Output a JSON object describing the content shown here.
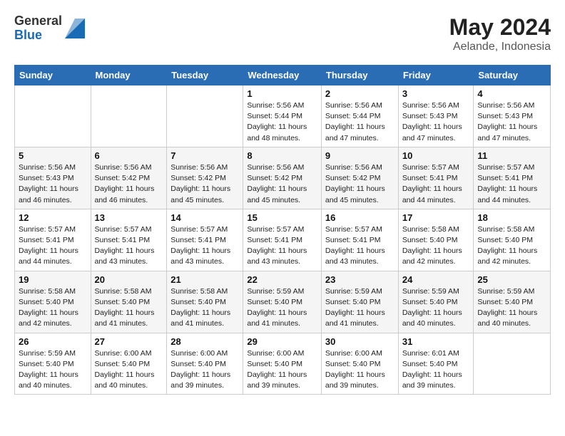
{
  "logo": {
    "general": "General",
    "blue": "Blue"
  },
  "title": {
    "month_year": "May 2024",
    "location": "Aelande, Indonesia"
  },
  "headers": [
    "Sunday",
    "Monday",
    "Tuesday",
    "Wednesday",
    "Thursday",
    "Friday",
    "Saturday"
  ],
  "weeks": [
    [
      {
        "day": "",
        "info": ""
      },
      {
        "day": "",
        "info": ""
      },
      {
        "day": "",
        "info": ""
      },
      {
        "day": "1",
        "info": "Sunrise: 5:56 AM\nSunset: 5:44 PM\nDaylight: 11 hours\nand 48 minutes."
      },
      {
        "day": "2",
        "info": "Sunrise: 5:56 AM\nSunset: 5:44 PM\nDaylight: 11 hours\nand 47 minutes."
      },
      {
        "day": "3",
        "info": "Sunrise: 5:56 AM\nSunset: 5:43 PM\nDaylight: 11 hours\nand 47 minutes."
      },
      {
        "day": "4",
        "info": "Sunrise: 5:56 AM\nSunset: 5:43 PM\nDaylight: 11 hours\nand 47 minutes."
      }
    ],
    [
      {
        "day": "5",
        "info": "Sunrise: 5:56 AM\nSunset: 5:43 PM\nDaylight: 11 hours\nand 46 minutes."
      },
      {
        "day": "6",
        "info": "Sunrise: 5:56 AM\nSunset: 5:42 PM\nDaylight: 11 hours\nand 46 minutes."
      },
      {
        "day": "7",
        "info": "Sunrise: 5:56 AM\nSunset: 5:42 PM\nDaylight: 11 hours\nand 45 minutes."
      },
      {
        "day": "8",
        "info": "Sunrise: 5:56 AM\nSunset: 5:42 PM\nDaylight: 11 hours\nand 45 minutes."
      },
      {
        "day": "9",
        "info": "Sunrise: 5:56 AM\nSunset: 5:42 PM\nDaylight: 11 hours\nand 45 minutes."
      },
      {
        "day": "10",
        "info": "Sunrise: 5:57 AM\nSunset: 5:41 PM\nDaylight: 11 hours\nand 44 minutes."
      },
      {
        "day": "11",
        "info": "Sunrise: 5:57 AM\nSunset: 5:41 PM\nDaylight: 11 hours\nand 44 minutes."
      }
    ],
    [
      {
        "day": "12",
        "info": "Sunrise: 5:57 AM\nSunset: 5:41 PM\nDaylight: 11 hours\nand 44 minutes."
      },
      {
        "day": "13",
        "info": "Sunrise: 5:57 AM\nSunset: 5:41 PM\nDaylight: 11 hours\nand 43 minutes."
      },
      {
        "day": "14",
        "info": "Sunrise: 5:57 AM\nSunset: 5:41 PM\nDaylight: 11 hours\nand 43 minutes."
      },
      {
        "day": "15",
        "info": "Sunrise: 5:57 AM\nSunset: 5:41 PM\nDaylight: 11 hours\nand 43 minutes."
      },
      {
        "day": "16",
        "info": "Sunrise: 5:57 AM\nSunset: 5:41 PM\nDaylight: 11 hours\nand 43 minutes."
      },
      {
        "day": "17",
        "info": "Sunrise: 5:58 AM\nSunset: 5:40 PM\nDaylight: 11 hours\nand 42 minutes."
      },
      {
        "day": "18",
        "info": "Sunrise: 5:58 AM\nSunset: 5:40 PM\nDaylight: 11 hours\nand 42 minutes."
      }
    ],
    [
      {
        "day": "19",
        "info": "Sunrise: 5:58 AM\nSunset: 5:40 PM\nDaylight: 11 hours\nand 42 minutes."
      },
      {
        "day": "20",
        "info": "Sunrise: 5:58 AM\nSunset: 5:40 PM\nDaylight: 11 hours\nand 41 minutes."
      },
      {
        "day": "21",
        "info": "Sunrise: 5:58 AM\nSunset: 5:40 PM\nDaylight: 11 hours\nand 41 minutes."
      },
      {
        "day": "22",
        "info": "Sunrise: 5:59 AM\nSunset: 5:40 PM\nDaylight: 11 hours\nand 41 minutes."
      },
      {
        "day": "23",
        "info": "Sunrise: 5:59 AM\nSunset: 5:40 PM\nDaylight: 11 hours\nand 41 minutes."
      },
      {
        "day": "24",
        "info": "Sunrise: 5:59 AM\nSunset: 5:40 PM\nDaylight: 11 hours\nand 40 minutes."
      },
      {
        "day": "25",
        "info": "Sunrise: 5:59 AM\nSunset: 5:40 PM\nDaylight: 11 hours\nand 40 minutes."
      }
    ],
    [
      {
        "day": "26",
        "info": "Sunrise: 5:59 AM\nSunset: 5:40 PM\nDaylight: 11 hours\nand 40 minutes."
      },
      {
        "day": "27",
        "info": "Sunrise: 6:00 AM\nSunset: 5:40 PM\nDaylight: 11 hours\nand 40 minutes."
      },
      {
        "day": "28",
        "info": "Sunrise: 6:00 AM\nSunset: 5:40 PM\nDaylight: 11 hours\nand 39 minutes."
      },
      {
        "day": "29",
        "info": "Sunrise: 6:00 AM\nSunset: 5:40 PM\nDaylight: 11 hours\nand 39 minutes."
      },
      {
        "day": "30",
        "info": "Sunrise: 6:00 AM\nSunset: 5:40 PM\nDaylight: 11 hours\nand 39 minutes."
      },
      {
        "day": "31",
        "info": "Sunrise: 6:01 AM\nSunset: 5:40 PM\nDaylight: 11 hours\nand 39 minutes."
      },
      {
        "day": "",
        "info": ""
      }
    ]
  ]
}
